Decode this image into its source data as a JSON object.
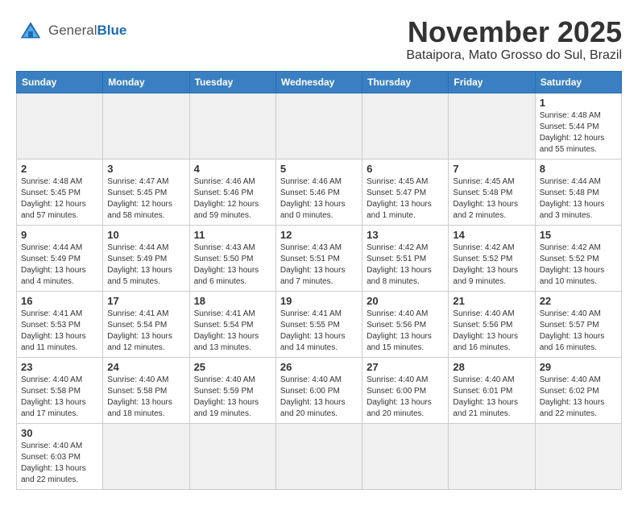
{
  "header": {
    "logo_general": "General",
    "logo_blue": "Blue",
    "month_title": "November 2025",
    "location": "Bataipora, Mato Grosso do Sul, Brazil"
  },
  "days_of_week": [
    "Sunday",
    "Monday",
    "Tuesday",
    "Wednesday",
    "Thursday",
    "Friday",
    "Saturday"
  ],
  "weeks": [
    [
      {
        "date": "",
        "info": ""
      },
      {
        "date": "",
        "info": ""
      },
      {
        "date": "",
        "info": ""
      },
      {
        "date": "",
        "info": ""
      },
      {
        "date": "",
        "info": ""
      },
      {
        "date": "",
        "info": ""
      },
      {
        "date": "1",
        "info": "Sunrise: 4:48 AM\nSunset: 5:44 PM\nDaylight: 12 hours and 55 minutes."
      }
    ],
    [
      {
        "date": "2",
        "info": "Sunrise: 4:48 AM\nSunset: 5:45 PM\nDaylight: 12 hours and 57 minutes."
      },
      {
        "date": "3",
        "info": "Sunrise: 4:47 AM\nSunset: 5:45 PM\nDaylight: 12 hours and 58 minutes."
      },
      {
        "date": "4",
        "info": "Sunrise: 4:46 AM\nSunset: 5:46 PM\nDaylight: 12 hours and 59 minutes."
      },
      {
        "date": "5",
        "info": "Sunrise: 4:46 AM\nSunset: 5:46 PM\nDaylight: 13 hours and 0 minutes."
      },
      {
        "date": "6",
        "info": "Sunrise: 4:45 AM\nSunset: 5:47 PM\nDaylight: 13 hours and 1 minute."
      },
      {
        "date": "7",
        "info": "Sunrise: 4:45 AM\nSunset: 5:48 PM\nDaylight: 13 hours and 2 minutes."
      },
      {
        "date": "8",
        "info": "Sunrise: 4:44 AM\nSunset: 5:48 PM\nDaylight: 13 hours and 3 minutes."
      }
    ],
    [
      {
        "date": "9",
        "info": "Sunrise: 4:44 AM\nSunset: 5:49 PM\nDaylight: 13 hours and 4 minutes."
      },
      {
        "date": "10",
        "info": "Sunrise: 4:44 AM\nSunset: 5:49 PM\nDaylight: 13 hours and 5 minutes."
      },
      {
        "date": "11",
        "info": "Sunrise: 4:43 AM\nSunset: 5:50 PM\nDaylight: 13 hours and 6 minutes."
      },
      {
        "date": "12",
        "info": "Sunrise: 4:43 AM\nSunset: 5:51 PM\nDaylight: 13 hours and 7 minutes."
      },
      {
        "date": "13",
        "info": "Sunrise: 4:42 AM\nSunset: 5:51 PM\nDaylight: 13 hours and 8 minutes."
      },
      {
        "date": "14",
        "info": "Sunrise: 4:42 AM\nSunset: 5:52 PM\nDaylight: 13 hours and 9 minutes."
      },
      {
        "date": "15",
        "info": "Sunrise: 4:42 AM\nSunset: 5:52 PM\nDaylight: 13 hours and 10 minutes."
      }
    ],
    [
      {
        "date": "16",
        "info": "Sunrise: 4:41 AM\nSunset: 5:53 PM\nDaylight: 13 hours and 11 minutes."
      },
      {
        "date": "17",
        "info": "Sunrise: 4:41 AM\nSunset: 5:54 PM\nDaylight: 13 hours and 12 minutes."
      },
      {
        "date": "18",
        "info": "Sunrise: 4:41 AM\nSunset: 5:54 PM\nDaylight: 13 hours and 13 minutes."
      },
      {
        "date": "19",
        "info": "Sunrise: 4:41 AM\nSunset: 5:55 PM\nDaylight: 13 hours and 14 minutes."
      },
      {
        "date": "20",
        "info": "Sunrise: 4:40 AM\nSunset: 5:56 PM\nDaylight: 13 hours and 15 minutes."
      },
      {
        "date": "21",
        "info": "Sunrise: 4:40 AM\nSunset: 5:56 PM\nDaylight: 13 hours and 16 minutes."
      },
      {
        "date": "22",
        "info": "Sunrise: 4:40 AM\nSunset: 5:57 PM\nDaylight: 13 hours and 16 minutes."
      }
    ],
    [
      {
        "date": "23",
        "info": "Sunrise: 4:40 AM\nSunset: 5:58 PM\nDaylight: 13 hours and 17 minutes."
      },
      {
        "date": "24",
        "info": "Sunrise: 4:40 AM\nSunset: 5:58 PM\nDaylight: 13 hours and 18 minutes."
      },
      {
        "date": "25",
        "info": "Sunrise: 4:40 AM\nSunset: 5:59 PM\nDaylight: 13 hours and 19 minutes."
      },
      {
        "date": "26",
        "info": "Sunrise: 4:40 AM\nSunset: 6:00 PM\nDaylight: 13 hours and 20 minutes."
      },
      {
        "date": "27",
        "info": "Sunrise: 4:40 AM\nSunset: 6:00 PM\nDaylight: 13 hours and 20 minutes."
      },
      {
        "date": "28",
        "info": "Sunrise: 4:40 AM\nSunset: 6:01 PM\nDaylight: 13 hours and 21 minutes."
      },
      {
        "date": "29",
        "info": "Sunrise: 4:40 AM\nSunset: 6:02 PM\nDaylight: 13 hours and 22 minutes."
      }
    ],
    [
      {
        "date": "30",
        "info": "Sunrise: 4:40 AM\nSunset: 6:03 PM\nDaylight: 13 hours and 22 minutes."
      },
      {
        "date": "",
        "info": ""
      },
      {
        "date": "",
        "info": ""
      },
      {
        "date": "",
        "info": ""
      },
      {
        "date": "",
        "info": ""
      },
      {
        "date": "",
        "info": ""
      },
      {
        "date": "",
        "info": ""
      }
    ]
  ]
}
